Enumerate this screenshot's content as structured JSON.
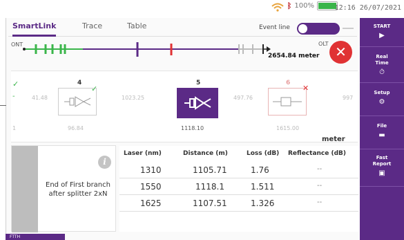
{
  "status": {
    "battery": "100%",
    "time": "12:16",
    "date": "26/07/2021"
  },
  "tabs": [
    {
      "label": "SmartLink"
    },
    {
      "label": "Trace"
    },
    {
      "label": "Table"
    }
  ],
  "event_line": {
    "label": "Event line",
    "on": true
  },
  "link": {
    "ont_label": "ONT",
    "olt_label": "OLT",
    "length": "2654.84 meter"
  },
  "events": {
    "left_values": [
      "41.48",
      "1023.25",
      "497.76",
      "997"
    ],
    "numbers": [
      "4",
      "5",
      "6"
    ],
    "distances": [
      "96.84",
      "1118.10",
      "1615.00"
    ],
    "edge_value": "1",
    "unit": "meter"
  },
  "info": {
    "icon": "info-icon",
    "text": "End of First branch after splitter 2xN"
  },
  "table": {
    "headers": [
      "Laser (nm)",
      "Distance (m)",
      "Loss (dB)",
      "Reflectance (dB)"
    ],
    "rows": [
      {
        "laser": "1310",
        "distance": "1105.71",
        "loss": "1.76",
        "reflectance": "--"
      },
      {
        "laser": "1550",
        "distance": "1118.1",
        "loss": "1.511",
        "reflectance": "--"
      },
      {
        "laser": "1625",
        "distance": "1107.51",
        "loss": "1.326",
        "reflectance": "--"
      }
    ]
  },
  "sidebar": [
    {
      "label": "START",
      "icon": "▶"
    },
    {
      "label": "Real Time",
      "icon": "⏱"
    },
    {
      "label": "Setup",
      "icon": "⚙"
    },
    {
      "label": "File",
      "icon": "▬"
    },
    {
      "label": "Fast Report",
      "icon": "▣"
    }
  ],
  "bottom_tag": "FTTH",
  "colors": {
    "accent": "#5b2a86",
    "danger": "#e03234",
    "ok": "#3ab54a"
  }
}
